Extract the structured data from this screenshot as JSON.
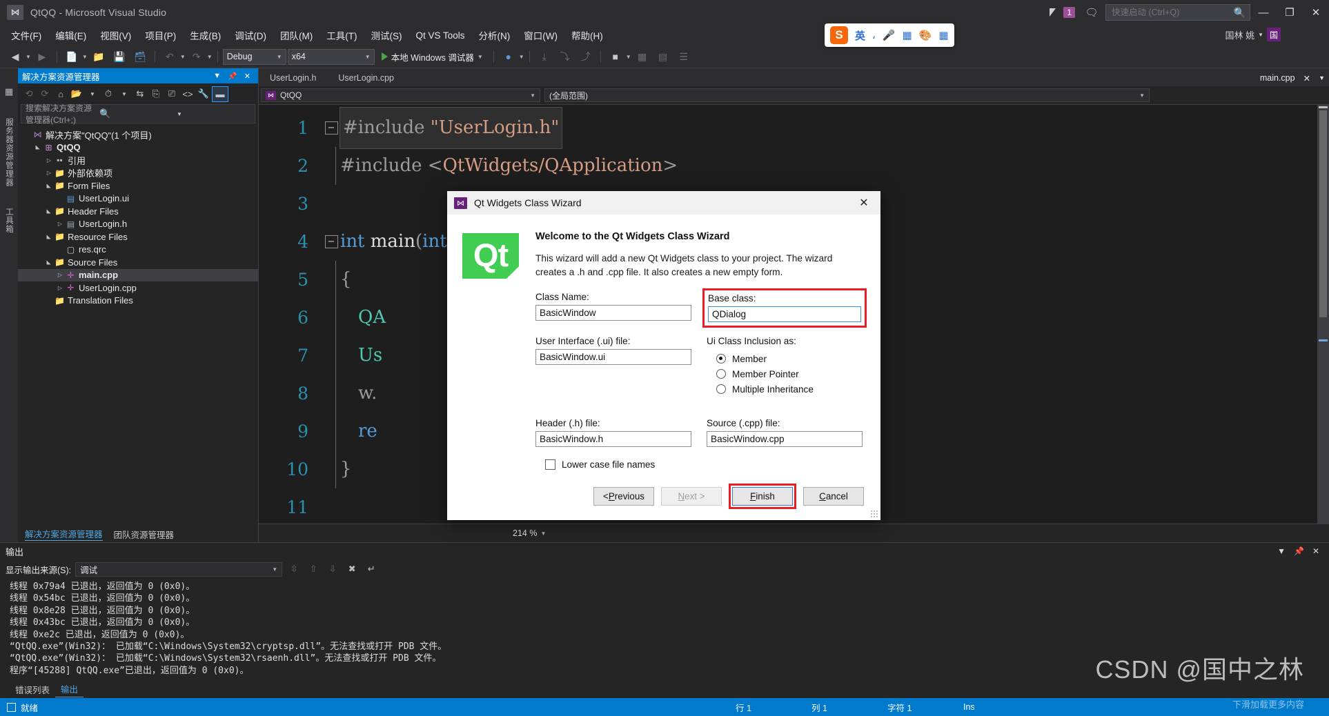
{
  "window": {
    "title": "QtQQ - Microsoft Visual Studio",
    "logo_icon": "visual-studio-icon",
    "notification_count": "1",
    "feedback_icon": "feedback-icon",
    "filter_icon": "filter-icon",
    "quick_launch_placeholder": "快速启动 (Ctrl+Q)",
    "search_icon": "search-icon",
    "minimize": "—",
    "restore": "❐",
    "close": "✕",
    "account_name": "国林 姚",
    "account_badge": "国"
  },
  "menu": {
    "items": [
      "文件(F)",
      "编辑(E)",
      "视图(V)",
      "项目(P)",
      "生成(B)",
      "调试(D)",
      "团队(M)",
      "工具(T)",
      "测试(S)",
      "Qt VS Tools",
      "分析(N)",
      "窗口(W)",
      "帮助(H)"
    ]
  },
  "ime": {
    "brand": "S",
    "mode": "英",
    "tools": [
      "voice-icon",
      "keyboard-icon",
      "skin-icon",
      "apps-icon"
    ]
  },
  "toolbar": {
    "back_icon": "navigate-back-icon",
    "forward_icon": "navigate-forward-icon",
    "new_icon": "new-file-icon",
    "open_icon": "open-file-icon",
    "save_icon": "save-icon",
    "save_all_icon": "save-all-icon",
    "undo_icon": "undo-icon",
    "redo_icon": "redo-icon",
    "configuration": "Debug",
    "platform": "x64",
    "run_label": "本地 Windows 调试器",
    "run_icon": "play-icon",
    "extra_icons": [
      "bug-icon",
      "stack-icon",
      "panel-icon",
      "stop-icon",
      "step-icon",
      "grid-icon",
      "table-icon",
      "list-icon"
    ]
  },
  "left_rail": {
    "items": [
      "服务器资源管理器",
      "工具箱"
    ]
  },
  "solution_explorer": {
    "title": "解决方案资源管理器",
    "dropdown_icon": "chevron-down-icon",
    "pin_icon": "pin-icon",
    "close_icon": "close-icon",
    "tool_icons": [
      "back-icon",
      "forward-icon",
      "home-icon",
      "switch-views-icon",
      "chevron-down-icon",
      "pending-changes-icon",
      "chevron-down-icon",
      "sync-icon",
      "refresh-icon",
      "collapse-all-icon",
      "show-all-files-icon",
      "properties-icon",
      "preview-icon"
    ],
    "search_placeholder": "搜索解决方案资源管理器(Ctrl+;)",
    "search_icon": "search-icon",
    "tree": [
      {
        "label": "解决方案\"QtQQ\"(1 个项目)",
        "depth": 0,
        "arrow": "",
        "icon": "solution-icon",
        "bold": false,
        "selected": false
      },
      {
        "label": "QtQQ",
        "depth": 1,
        "arrow": "open",
        "icon": "project-icon",
        "bold": true,
        "selected": false
      },
      {
        "label": "引用",
        "depth": 2,
        "arrow": "closed",
        "icon": "references-icon",
        "bold": false,
        "selected": false
      },
      {
        "label": "外部依赖项",
        "depth": 2,
        "arrow": "closed",
        "icon": "folder-icon",
        "bold": false,
        "selected": false
      },
      {
        "label": "Form Files",
        "depth": 2,
        "arrow": "open",
        "icon": "filter-folder-icon",
        "bold": false,
        "selected": false
      },
      {
        "label": "UserLogin.ui",
        "depth": 3,
        "arrow": "",
        "icon": "ui-file-icon",
        "bold": false,
        "selected": false
      },
      {
        "label": "Header Files",
        "depth": 2,
        "arrow": "open",
        "icon": "filter-folder-icon",
        "bold": false,
        "selected": false
      },
      {
        "label": "UserLogin.h",
        "depth": 3,
        "arrow": "closed",
        "icon": "h-file-icon",
        "bold": false,
        "selected": false
      },
      {
        "label": "Resource Files",
        "depth": 2,
        "arrow": "open",
        "icon": "filter-folder-icon",
        "bold": false,
        "selected": false
      },
      {
        "label": "res.qrc",
        "depth": 3,
        "arrow": "",
        "icon": "file-icon",
        "bold": false,
        "selected": false
      },
      {
        "label": "Source Files",
        "depth": 2,
        "arrow": "open",
        "icon": "filter-folder-icon",
        "bold": false,
        "selected": false
      },
      {
        "label": "main.cpp",
        "depth": 3,
        "arrow": "closed",
        "icon": "cpp-file-icon",
        "bold": true,
        "selected": true
      },
      {
        "label": "UserLogin.cpp",
        "depth": 3,
        "arrow": "closed",
        "icon": "cpp-file-icon",
        "bold": false,
        "selected": false
      },
      {
        "label": "Translation Files",
        "depth": 2,
        "arrow": "",
        "icon": "folder-icon",
        "bold": false,
        "selected": false
      }
    ],
    "bottom_tabs": [
      {
        "label": "解决方案资源管理器",
        "active": true
      },
      {
        "label": "团队资源管理器",
        "active": false
      }
    ]
  },
  "editor": {
    "tabs": [
      {
        "label": "UserLogin.h",
        "active": false
      },
      {
        "label": "UserLogin.cpp",
        "active": false
      },
      {
        "label": "main.cpp",
        "active": true
      }
    ],
    "tab_close_icon": "close-icon",
    "tab_menu_icon": "chevron-down-icon",
    "project_scope": "QtQQ",
    "project_icon": "cpp-project-icon",
    "member_scope": "(全局范围)",
    "zoom_level": "214 %",
    "lines": [
      {
        "n": "1",
        "fold": "minus",
        "text": "#include \"UserLogin.h\"",
        "highlight": true
      },
      {
        "n": "2",
        "fold": "bar",
        "text": "#include <QtWidgets/QApplication>",
        "highlight": false
      },
      {
        "n": "3",
        "fold": "",
        "text": "",
        "highlight": false
      },
      {
        "n": "4",
        "fold": "minus",
        "text": "int main(int argc, char *argv[])",
        "highlight": false
      },
      {
        "n": "5",
        "fold": "",
        "text": "{",
        "highlight": false
      },
      {
        "n": "6",
        "fold": "",
        "text": "QA",
        "highlight": false
      },
      {
        "n": "7",
        "fold": "",
        "text": "Us",
        "highlight": false
      },
      {
        "n": "8",
        "fold": "",
        "text": "w.",
        "highlight": false
      },
      {
        "n": "9",
        "fold": "",
        "text": "re",
        "highlight": false
      },
      {
        "n": "10",
        "fold": "",
        "text": "}",
        "highlight": false
      },
      {
        "n": "11",
        "fold": "",
        "text": "",
        "highlight": false
      }
    ]
  },
  "output": {
    "title": "输出",
    "dropdown_icon": "chevron-down-icon",
    "pin_icon": "pin-icon",
    "close_icon": "close-icon",
    "source_label": "显示输出来源(S):",
    "source_value": "调试",
    "tool_icons": [
      "goto-message-icon",
      "previous-message-icon",
      "next-message-icon",
      "clear-all-icon",
      "word-wrap-icon"
    ],
    "lines": [
      "线程 0x79a4 已退出，返回值为 0 (0x0)。",
      "线程 0x54bc 已退出，返回值为 0 (0x0)。",
      "线程 0x8e28 已退出，返回值为 0 (0x0)。",
      "线程 0x43bc 已退出，返回值为 0 (0x0)。",
      "线程 0xe2c 已退出，返回值为 0 (0x0)。",
      "“QtQQ.exe”(Win32)： 已加载“C:\\Windows\\System32\\cryptsp.dll”。无法查找或打开 PDB 文件。",
      "“QtQQ.exe”(Win32)： 已加载“C:\\Windows\\System32\\rsaenh.dll”。无法查找或打开 PDB 文件。",
      "程序“[45288] QtQQ.exe”已退出，返回值为 0 (0x0)。"
    ],
    "tabs": [
      {
        "label": "错误列表",
        "active": false
      },
      {
        "label": "输出",
        "active": true
      }
    ]
  },
  "statusbar": {
    "ready": "就绪",
    "ready_icon": "status-icon",
    "line_label": "行 1",
    "column_label": "列 1",
    "char_label": "字符 1",
    "insert_mode": "Ins"
  },
  "dialog": {
    "icon": "visual-studio-icon",
    "title": "Qt Widgets Class Wizard",
    "close_icon": "close-icon",
    "logo_text": "Qt",
    "heading": "Welcome to the Qt Widgets Class Wizard",
    "description": "This wizard will add a new Qt Widgets class to your project. The wizard creates a .h and .cpp file. It also creates a new empty form.",
    "fields": {
      "class_name_label": "Class Name:",
      "class_name_value": "BasicWindow",
      "base_class_label": "Base class:",
      "base_class_value": "QDialog",
      "ui_file_label": "User Interface (.ui) file:",
      "ui_file_value": "BasicWindow.ui",
      "header_label": "Header (.h) file:",
      "header_value": "BasicWindow.h",
      "source_label": "Source (.cpp) file:",
      "source_value": "BasicWindow.cpp"
    },
    "inclusion": {
      "label": "Ui Class Inclusion as:",
      "options": [
        {
          "label": "Member",
          "selected": true
        },
        {
          "label": "Member Pointer",
          "selected": false
        },
        {
          "label": "Multiple Inheritance",
          "selected": false
        }
      ]
    },
    "lowercase_label": "Lower case file names",
    "lowercase_checked": false,
    "buttons": [
      {
        "id": "previous",
        "label": "< Previous",
        "state": "normal",
        "mnemonic": "P"
      },
      {
        "id": "next",
        "label": "Next >",
        "state": "disabled",
        "mnemonic": "N"
      },
      {
        "id": "finish",
        "label": "Finish",
        "state": "default",
        "mnemonic": "F"
      },
      {
        "id": "cancel",
        "label": "Cancel",
        "state": "normal",
        "mnemonic": "C"
      }
    ],
    "highlight_color": "#ec1c24"
  },
  "watermark": {
    "text": "CSDN @国中之林",
    "sub": "下滑加载更多内容"
  }
}
